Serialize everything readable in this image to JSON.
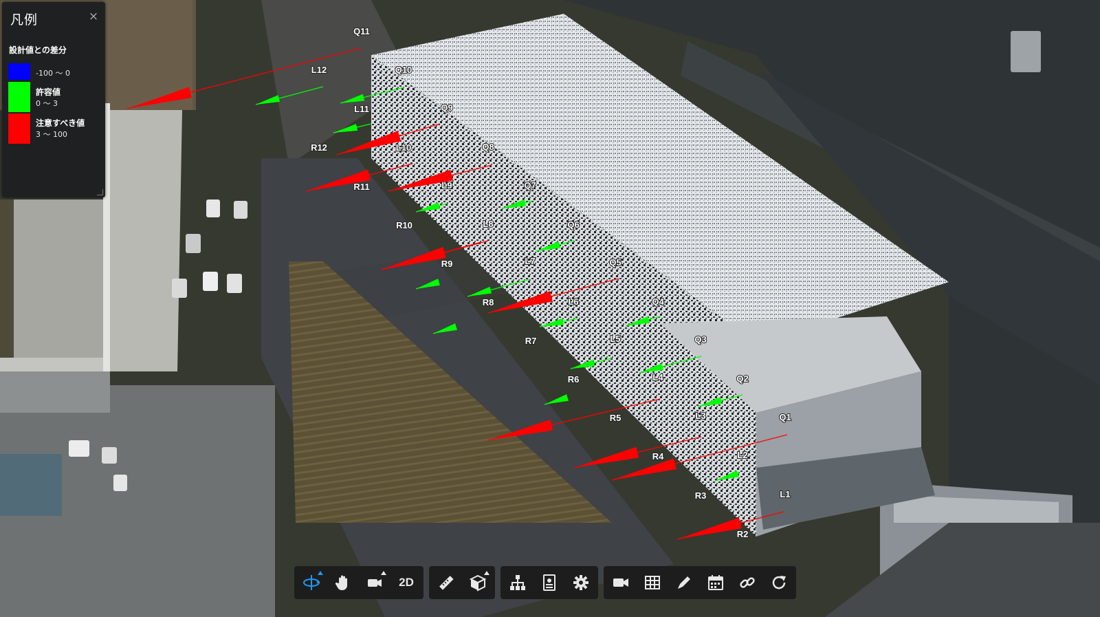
{
  "legend": {
    "title": "凡例",
    "close_glyph": "×",
    "heading": "設計値との差分",
    "items": [
      {
        "color": "#0000ff",
        "label": "",
        "range": "-100 ～ 0"
      },
      {
        "color": "#00ff00",
        "label": "許容値",
        "range": "0 ～ 3"
      },
      {
        "color": "#ff0000",
        "label": "注意すべき値",
        "range": "3 ～ 100"
      }
    ]
  },
  "labels": [
    "Q11",
    "L12",
    "Q10",
    "L11",
    "Q9",
    "R12",
    "L10",
    "Q8",
    "R11",
    "L9",
    "Q7",
    "R10",
    "L8",
    "Q6",
    "R9",
    "L7",
    "Q5",
    "R8",
    "L6",
    "Q4",
    "R7",
    "L5",
    "Q3",
    "R6",
    "L4",
    "Q2",
    "R5",
    "L3",
    "Q1",
    "R4",
    "L2",
    "R3",
    "L1",
    "R2"
  ],
  "toolbar": {
    "groups": [
      [
        {
          "icon": "orbit-icon",
          "active": true,
          "corner": true
        },
        {
          "icon": "hand-pan-icon"
        },
        {
          "icon": "camera-view-icon",
          "corner": true
        },
        {
          "icon": "text",
          "text": "2D"
        }
      ],
      [
        {
          "icon": "ruler-icon"
        },
        {
          "icon": "cube-section-icon",
          "corner": true
        }
      ],
      [
        {
          "icon": "hierarchy-icon"
        },
        {
          "icon": "properties-icon"
        },
        {
          "icon": "gear-icon"
        }
      ],
      [
        {
          "icon": "video-camera-icon"
        },
        {
          "icon": "grid-table-icon"
        },
        {
          "icon": "pencil-icon"
        },
        {
          "icon": "calendar-icon"
        },
        {
          "icon": "link-icon"
        },
        {
          "icon": "reload-icon"
        }
      ]
    ]
  },
  "colors": {
    "accent": "#2196f3",
    "ok": "#00ff00",
    "warn": "#ff0000",
    "low": "#0000ff"
  }
}
